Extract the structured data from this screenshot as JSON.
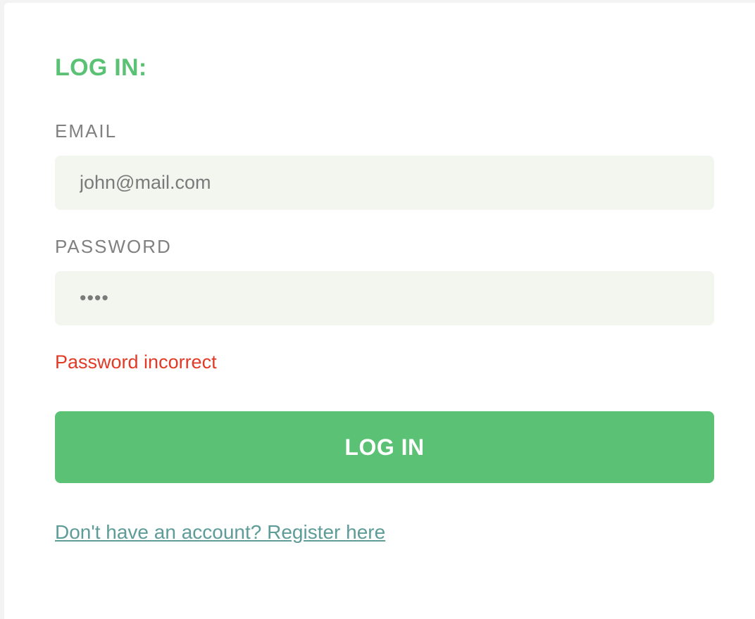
{
  "colors": {
    "accent": "#5bc275",
    "input_bg": "#f2f6ef",
    "label": "#808080",
    "error": "#e23a26",
    "link": "#5e9c98"
  },
  "login_form": {
    "title": "LOG IN:",
    "email": {
      "label": "EMAIL",
      "value": "john@mail.com"
    },
    "password": {
      "label": "PASSWORD",
      "value": "••••"
    },
    "error_message": "Password incorrect",
    "submit_label": "LOG IN",
    "register_link": "Don't have an account? Register here"
  }
}
